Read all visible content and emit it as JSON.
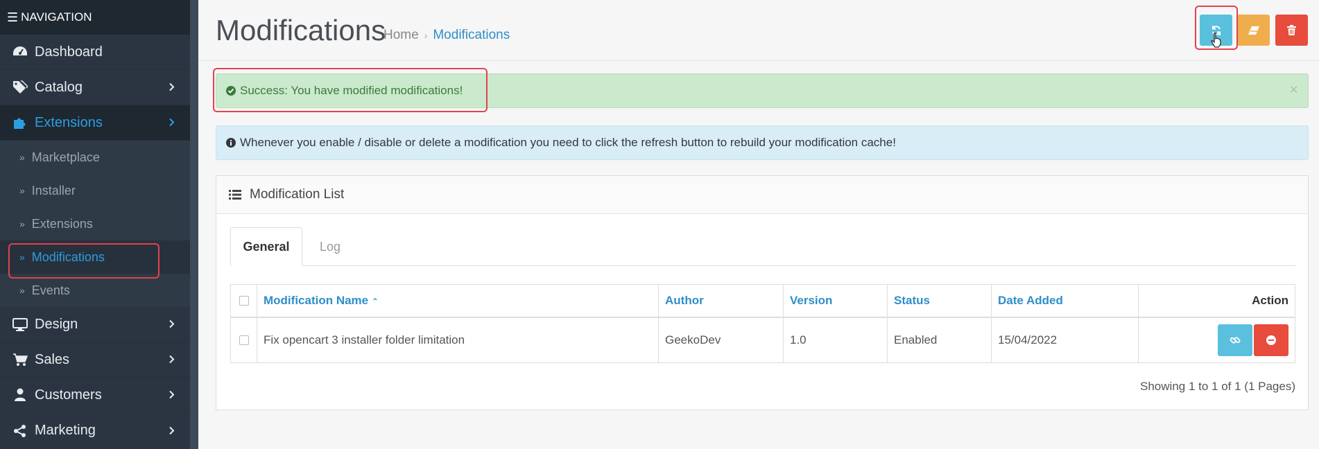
{
  "sidebar": {
    "header": "NAVIGATION",
    "items": [
      {
        "label": "Dashboard"
      },
      {
        "label": "Catalog"
      },
      {
        "label": "Extensions"
      },
      {
        "label": "Design"
      },
      {
        "label": "Sales"
      },
      {
        "label": "Customers"
      },
      {
        "label": "Marketing"
      }
    ],
    "subitems": [
      {
        "label": "Marketplace"
      },
      {
        "label": "Installer"
      },
      {
        "label": "Extensions"
      },
      {
        "label": "Modifications"
      },
      {
        "label": "Events"
      }
    ]
  },
  "header": {
    "title": "Modifications",
    "breadcrumb": [
      "Home",
      "Modifications"
    ]
  },
  "alerts": {
    "success": "Success: You have modified modifications!",
    "close": "×",
    "info": "Whenever you enable / disable or delete a modification you need to click the refresh button to rebuild your modification cache!"
  },
  "panel": {
    "title": "Modification List",
    "tabs": [
      "General",
      "Log"
    ],
    "columns": [
      "Modification Name",
      "Author",
      "Version",
      "Status",
      "Date Added",
      "Action"
    ],
    "rows": [
      {
        "name": "Fix opencart 3 installer folder limitation",
        "author": "GeekoDev",
        "version": "1.0",
        "status": "Enabled",
        "date_added": "15/04/2022"
      }
    ],
    "pagination": "Showing 1 to 1 of 1 (1 Pages)"
  },
  "colors": {
    "accent": "#2e8ec9",
    "sidebar_bg": "#2b3542",
    "info_button": "#5bc0de",
    "warning_button": "#f0ad4e",
    "danger_button": "#e74c3c",
    "success_bg": "#cbe9cc",
    "info_bg": "#d9edf7",
    "highlight": "#e0434e"
  },
  "icons": [
    "bars-icon",
    "dashboard-icon",
    "tags-icon",
    "puzzle-icon",
    "desktop-icon",
    "cart-icon",
    "user-icon",
    "share-icon",
    "refresh-icon",
    "eraser-icon",
    "trash-icon",
    "check-circle-icon",
    "info-circle-icon",
    "list-icon",
    "link-icon",
    "minus-circle-icon"
  ]
}
